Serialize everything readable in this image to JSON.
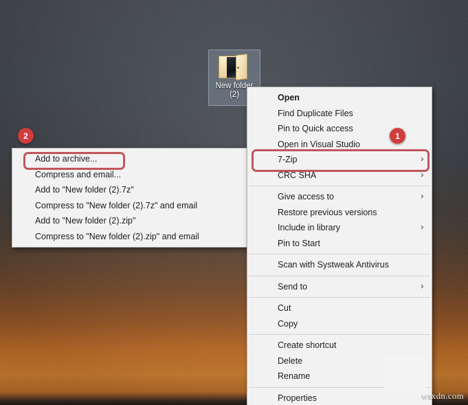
{
  "desktop": {
    "icon": {
      "name": "desktop-folder-icon",
      "label_line1": "New folder",
      "label_line2": "(2)"
    },
    "watermark": "wsxdn.com",
    "colors": {
      "badge": "#cf3d3d",
      "highlight": "#c0565a",
      "menu_bg": "#f2f2f2",
      "menu_border": "#b6b6b6",
      "text": "#1c1c1c"
    }
  },
  "annotations": {
    "badge_1": "1",
    "badge_2": "2"
  },
  "context_menu": {
    "items": [
      {
        "label": "Open",
        "bold": true,
        "submenu": false,
        "icon": null,
        "separator_after": false
      },
      {
        "label": "Find Duplicate Files",
        "bold": false,
        "submenu": false,
        "icon": null,
        "separator_after": false
      },
      {
        "label": "Pin to Quick access",
        "bold": false,
        "submenu": false,
        "icon": null,
        "separator_after": false
      },
      {
        "label": "Open in Visual Studio",
        "bold": false,
        "submenu": false,
        "icon": null,
        "separator_after": false
      },
      {
        "label": "7-Zip",
        "bold": false,
        "submenu": true,
        "icon": null,
        "separator_after": false
      },
      {
        "label": "CRC SHA",
        "bold": false,
        "submenu": true,
        "icon": null,
        "separator_after": true
      },
      {
        "label": "Give access to",
        "bold": false,
        "submenu": true,
        "icon": null,
        "separator_after": false
      },
      {
        "label": "Restore previous versions",
        "bold": false,
        "submenu": false,
        "icon": null,
        "separator_after": false
      },
      {
        "label": "Include in library",
        "bold": false,
        "submenu": true,
        "icon": null,
        "separator_after": false
      },
      {
        "label": "Pin to Start",
        "bold": false,
        "submenu": false,
        "icon": null,
        "separator_after": true
      },
      {
        "label": "Scan with Systweak Antivirus",
        "bold": false,
        "submenu": false,
        "icon": "shield-icon",
        "separator_after": true
      },
      {
        "label": "Send to",
        "bold": false,
        "submenu": true,
        "icon": null,
        "separator_after": true
      },
      {
        "label": "Cut",
        "bold": false,
        "submenu": false,
        "icon": null,
        "separator_after": false
      },
      {
        "label": "Copy",
        "bold": false,
        "submenu": false,
        "icon": null,
        "separator_after": true
      },
      {
        "label": "Create shortcut",
        "bold": false,
        "submenu": false,
        "icon": null,
        "separator_after": false
      },
      {
        "label": "Delete",
        "bold": false,
        "submenu": false,
        "icon": null,
        "separator_after": false
      },
      {
        "label": "Rename",
        "bold": false,
        "submenu": false,
        "icon": null,
        "separator_after": true
      },
      {
        "label": "Properties",
        "bold": false,
        "submenu": false,
        "icon": null,
        "separator_after": false
      }
    ],
    "highlighted_item": "7-Zip",
    "chevron_glyph": "›"
  },
  "submenu": {
    "title": "7-Zip",
    "items": [
      {
        "label": "Add to archive...",
        "highlighted": true
      },
      {
        "label": "Compress and email...",
        "highlighted": false
      },
      {
        "label": "Add to \"New folder (2).7z\"",
        "highlighted": false
      },
      {
        "label": "Compress to \"New folder (2).7z\" and email",
        "highlighted": false
      },
      {
        "label": "Add to \"New folder (2).zip\"",
        "highlighted": false
      },
      {
        "label": "Compress to \"New folder (2).zip\" and email",
        "highlighted": false
      }
    ]
  }
}
